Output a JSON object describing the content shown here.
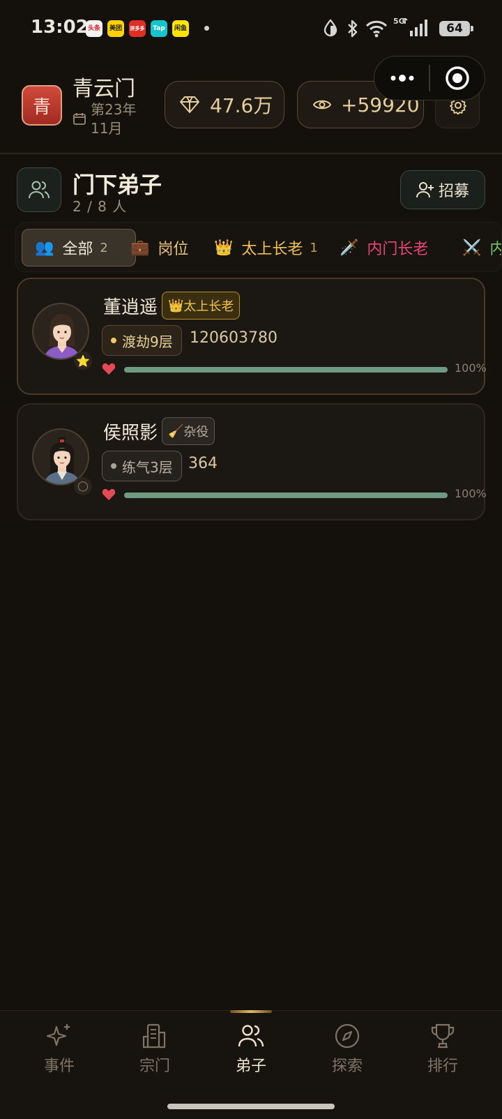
{
  "status_bar": {
    "time": "13:02",
    "apps": [
      "头条",
      "美团",
      "拼多多",
      "Tap",
      "闲鱼"
    ],
    "network": "5G",
    "battery": "64"
  },
  "header": {
    "sect_badge": "青",
    "sect_name": "青云门",
    "date": "第23年 11月",
    "spirit_stones": "47.6万",
    "views": "+59920"
  },
  "section": {
    "title": "门下弟子",
    "count": "2 / 8 人",
    "recruit_label": "招募"
  },
  "tabs": [
    {
      "icon": "👥",
      "label": "全部",
      "count": "2",
      "color": "#f0e7d6"
    },
    {
      "icon": "💼",
      "label": "岗位",
      "count": "",
      "color": "#e7c17a"
    },
    {
      "icon": "👑",
      "label": "太上长老",
      "count": "1",
      "color": "#f2c24e"
    },
    {
      "icon": "🗡️",
      "label": "内门长老",
      "count": "",
      "color": "#e8467a"
    },
    {
      "icon": "⚔️",
      "label": "内",
      "count": "",
      "color": "#74c36a"
    }
  ],
  "disciples": [
    {
      "name": "董逍遥",
      "role_icon": "👑",
      "role": "太上长老",
      "realm": "渡劫9层",
      "power": "120603780",
      "hp_percent": "100%",
      "hp": 1.0,
      "badge": "⭐"
    },
    {
      "name": "侯照影",
      "role_icon": "🧹",
      "role": "杂役",
      "realm": "练气3层",
      "power": "364",
      "hp_percent": "100%",
      "hp": 1.0,
      "badge": "◯"
    }
  ],
  "nav": [
    {
      "icon": "sparkle-icon",
      "label": "事件"
    },
    {
      "icon": "building-icon",
      "label": "宗门"
    },
    {
      "icon": "users-icon",
      "label": "弟子"
    },
    {
      "icon": "compass-icon",
      "label": "探索"
    },
    {
      "icon": "trophy-icon",
      "label": "排行"
    }
  ],
  "colors": {
    "background": "#14110d",
    "gold": "#e6cf9a",
    "active_tab_border": "#6a5a42",
    "hp_bar": "#6f9b82",
    "heart": "#e24a55"
  }
}
